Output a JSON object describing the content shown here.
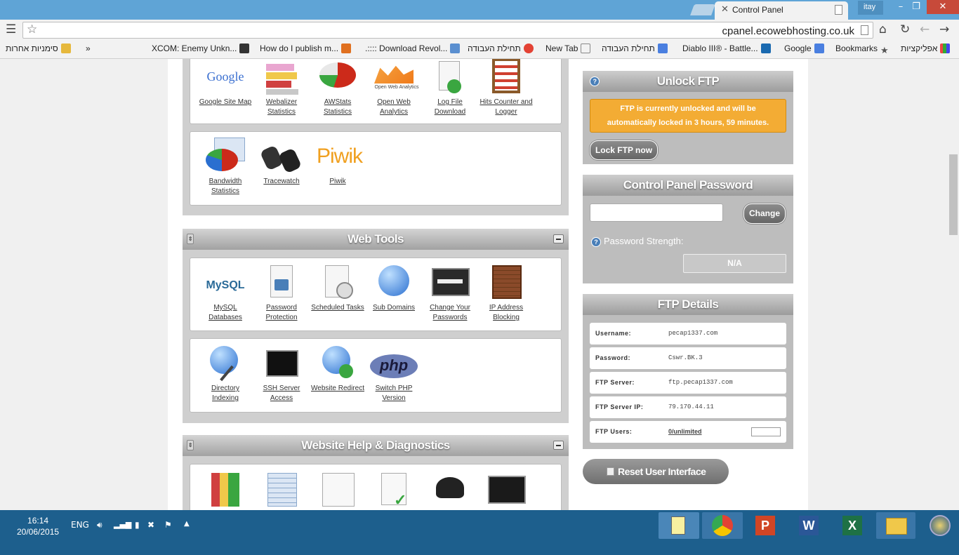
{
  "browser": {
    "tab_title": "Control Panel",
    "user": "itay",
    "url": "cpanel.ecowebhosting.co.uk",
    "bookmarks": [
      "אפליקציות",
      "Bookmarks",
      "Google",
      "Diablo III® - Battle...",
      "תחילת העבודה",
      "New Tab",
      "תחילת העבודה",
      ".:::: Download Revol...",
      "How do I publish m...",
      "XCOM: Enemy Unkn..."
    ],
    "other_bookmarks": "סימניות אחרות",
    "overflow": "»"
  },
  "stats_row1": [
    {
      "label": "Google Site Map",
      "icon": "google-icon"
    },
    {
      "label": "Webalizer Statistics",
      "icon": "bar-chart-icon"
    },
    {
      "label": "AWStats Statistics",
      "icon": "pie-chart-icon"
    },
    {
      "label": "Open Web Analytics",
      "icon": "owa-icon"
    },
    {
      "label": "Log File Download",
      "icon": "log-download-icon"
    },
    {
      "label": "Hits Counter and Logger",
      "icon": "abacus-icon"
    }
  ],
  "stats_row2": [
    {
      "label": "Bandwidth Statistics",
      "icon": "pie-chart-icon"
    },
    {
      "label": "Tracewatch",
      "icon": "binoculars-icon"
    },
    {
      "label": "Piwik",
      "icon": "piwik-icon"
    }
  ],
  "icon_text": {
    "google": "Google",
    "owa": "Open Web Analytics",
    "piwik": "Piwik",
    "mysql": "MySQL",
    "php": "php"
  },
  "web_tools": {
    "title": "Web Tools",
    "row1": [
      {
        "label": "MySQL Databases",
        "icon": "mysql-icon"
      },
      {
        "label": "Password Protection",
        "icon": "padlock-icon"
      },
      {
        "label": "Scheduled Tasks",
        "icon": "clock-doc-icon"
      },
      {
        "label": "Sub Domains",
        "icon": "globe-icon"
      },
      {
        "label": "Change Your Passwords",
        "icon": "password-screen-icon"
      },
      {
        "label": "IP Address Blocking",
        "icon": "brick-wall-icon"
      }
    ],
    "row2": [
      {
        "label": "Directory Indexing",
        "icon": "globe-pen-icon"
      },
      {
        "label": "SSH Server Access",
        "icon": "terminal-icon"
      },
      {
        "label": "Website Redirect",
        "icon": "globe-redirect-icon"
      },
      {
        "label": "Switch PHP Version",
        "icon": "php-icon"
      }
    ]
  },
  "diagnostics": {
    "title": "Website Help & Diagnostics"
  },
  "unlock_ftp": {
    "title": "Unlock FTP",
    "notice_line1": "FTP is currently unlocked and will be",
    "notice_line2": "automatically locked in 3 hours, 59 minutes.",
    "lock_button": "Lock FTP now"
  },
  "cp_password": {
    "title": "Control Panel Password",
    "change_button": "Change",
    "strength_label": "Password Strength:",
    "strength_value": "N/A"
  },
  "ftp_details": {
    "title": "FTP Details",
    "rows": [
      {
        "key": "Username:",
        "value": "pecap1337.com"
      },
      {
        "key": "Password:",
        "value": "Cswr.BK.3"
      },
      {
        "key": "FTP Server:",
        "value": "ftp.pecap1337.com"
      },
      {
        "key": "FTP Server IP:",
        "value": "79.170.44.11"
      },
      {
        "key": "FTP Users:",
        "value": "0/unlimited"
      }
    ]
  },
  "reset_button": "Reset User Interface",
  "taskbar": {
    "time": "16:14",
    "date": "20/06/2015",
    "lang": "ENG"
  },
  "colors": {
    "accent": "#5fa4d6",
    "warn": "#f3ac34",
    "taskbar": "#1d5f8d"
  }
}
